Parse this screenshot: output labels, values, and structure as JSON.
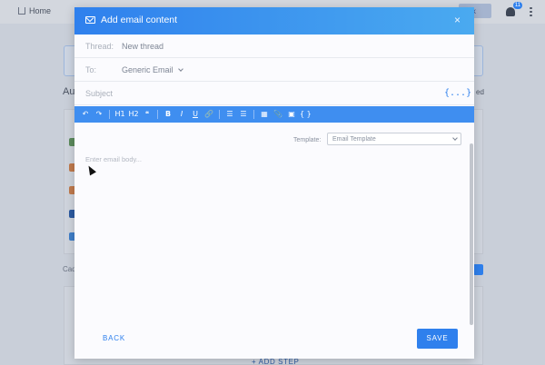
{
  "background": {
    "nav": {
      "home_label": "Home",
      "tab_label": "ook",
      "notification_count": "11"
    },
    "section_heading": "Au",
    "side_text": "ed",
    "caption": "Cad",
    "add_step_label": "+ ADD STEP"
  },
  "modal": {
    "title": "Add email content",
    "close_label": "×",
    "thread": {
      "label": "Thread:",
      "value": "New thread"
    },
    "to": {
      "label": "To:",
      "value": "Generic Email"
    },
    "subject": {
      "label": "Subject"
    },
    "variables_label": "{...}",
    "toolbar": {
      "undo": "↶",
      "redo": "↷",
      "h1": "H1",
      "h2": "H2",
      "quote": "❝",
      "bold": "B",
      "italic": "I",
      "underline": "U",
      "link": "🔗",
      "bullet_list": "☰",
      "numbered_list": "☰",
      "calendar": "▦",
      "attach": "📎",
      "image": "▣",
      "code": "{ }"
    },
    "template": {
      "label": "Template:",
      "value": "Email Template"
    },
    "body_placeholder": "Enter email body...",
    "back_label": "BACK",
    "save_label": "SAVE"
  },
  "colors": {
    "accent": "#2f80ed",
    "header_gradient_end": "#4aaaf0"
  }
}
